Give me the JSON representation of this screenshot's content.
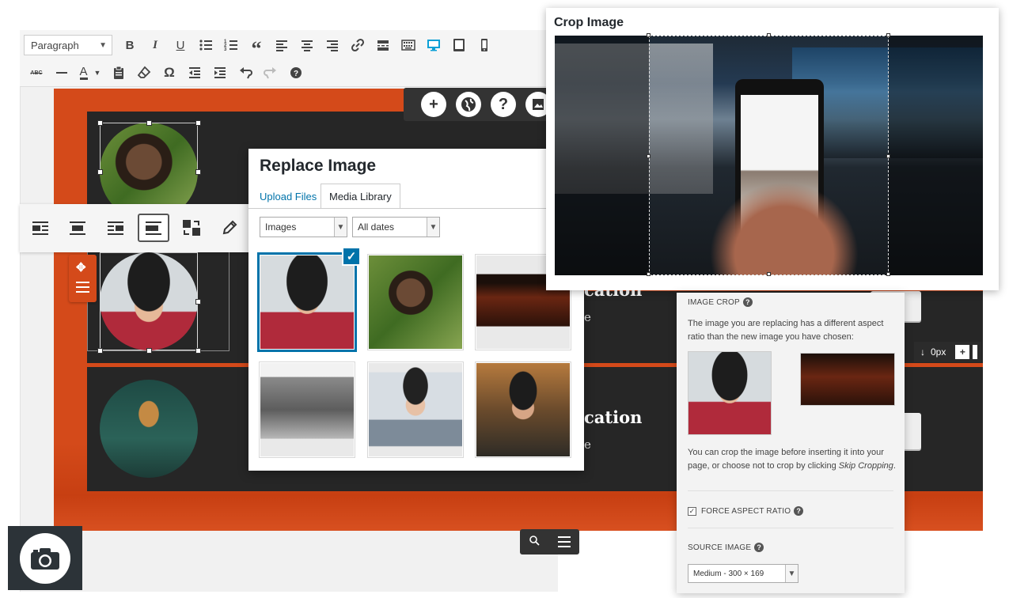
{
  "toolbar": {
    "paragraph_select": "Paragraph",
    "row1_icons": [
      "bold-icon",
      "italic-icon",
      "underline-icon",
      "bullet-list-icon",
      "numbered-list-icon",
      "blockquote-icon",
      "align-left-icon",
      "align-center-icon",
      "align-right-icon",
      "link-icon",
      "read-more-icon",
      "toolbar-toggle-icon",
      "desktop-preview-icon",
      "tablet-preview-icon",
      "mobile-preview-icon"
    ],
    "row2_icons": [
      "strikethrough-icon",
      "horizontal-line-icon",
      "text-color-icon",
      "paste-text-icon",
      "clear-formatting-icon",
      "special-character-icon",
      "outdent-icon",
      "indent-icon",
      "undo-icon",
      "redo-icon",
      "help-icon"
    ],
    "bold": "B",
    "italic": "I",
    "underline": "U",
    "omega": "Ω",
    "text_color": "A"
  },
  "canvas": {
    "heading_fragment_1": "cation",
    "heading_fragment_2": "cation",
    "text_fragment_1": "e",
    "text_fragment_2": "e",
    "spacing_value": "0px",
    "spacing_plus": "+"
  },
  "replace_image": {
    "title": "Replace Image",
    "tabs": [
      {
        "label": "Upload Files",
        "active": false
      },
      {
        "label": "Media Library",
        "active": true
      }
    ],
    "filter_type": "Images",
    "filter_date": "All dates"
  },
  "crop_image": {
    "title": "Crop Image"
  },
  "image_crop_panel": {
    "heading": "IMAGE CROP",
    "description": "The image you are replacing has a different aspect ratio than the new image you have chosen:",
    "description_line1": "The image you are replacing has a different aspect",
    "description_line2": "ratio than the new image you have chosen:",
    "crop_note_line1": "You can crop the image before inserting it into your",
    "crop_note_line2_a": "page, or choose not to crop by clicking ",
    "crop_note_skip": "Skip Cropping",
    "crop_note_end": ".",
    "force_aspect_label": "FORCE ASPECT RATIO",
    "force_aspect_checked": true,
    "source_image_label": "SOURCE IMAGE",
    "source_image_value": "Medium - 300 × 169"
  },
  "colors": {
    "accent_orange": "#d44a1a",
    "wp_blue": "#0073aa",
    "dark_panel": "#262626"
  }
}
